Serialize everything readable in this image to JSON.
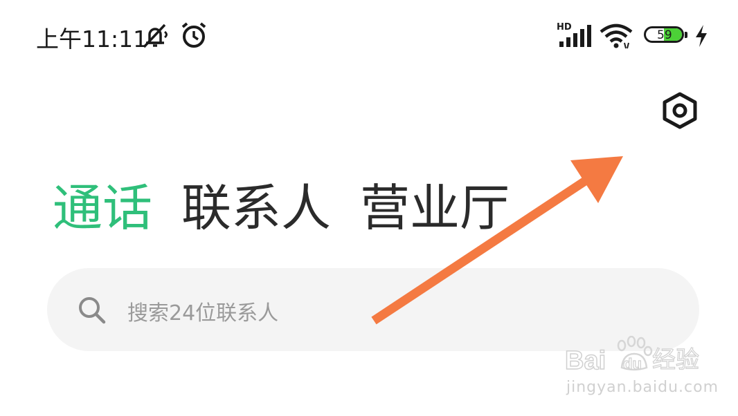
{
  "status_bar": {
    "time": "上午11:11",
    "network_label": "HD",
    "battery_level": "59",
    "icons": [
      "mute-notification-icon",
      "alarm-icon",
      "signal-icon",
      "wifi-icon",
      "battery-icon",
      "charging-icon"
    ]
  },
  "header": {
    "settings_icon": "gear-hexagon-icon"
  },
  "tabs": [
    {
      "label": "通话",
      "active": true
    },
    {
      "label": "联系人",
      "active": false
    },
    {
      "label": "营业厅",
      "active": false
    }
  ],
  "search": {
    "placeholder": "搜索24位联系人",
    "icon": "search-icon"
  },
  "annotation": {
    "arrow_color": "#f47a42"
  },
  "watermark": {
    "logo": "Baidu经验",
    "url": "jingyan.baidu.com"
  },
  "colors": {
    "active_tab": "#2fbf7a",
    "inactive_tab": "#2b2b2b",
    "search_bg": "#f4f4f4",
    "battery_fill": "#4cd137"
  }
}
